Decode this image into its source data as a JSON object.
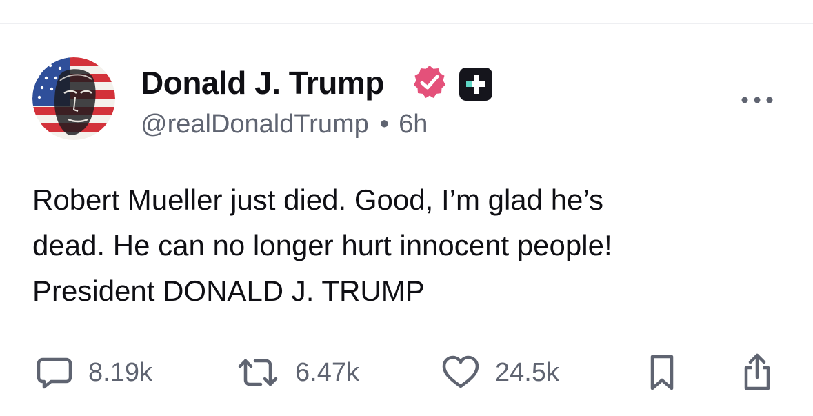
{
  "post": {
    "author": {
      "display_name": "Donald J. Trump",
      "handle": "@realDonaldTrump",
      "separator": "•",
      "time_ago": "6h",
      "avatar_icon": "flag-portrait-avatar",
      "verified_icon": "verified-badge-icon",
      "plus_icon": "plus-badge-icon"
    },
    "body": "Robert Mueller just died. Good, I’m glad he’s\ndead. He can no longer hurt innocent people!\nPresident DONALD J. TRUMP",
    "actions": {
      "reply_count": "8.19k",
      "retruth_count": "6.47k",
      "like_count": "24.5k"
    }
  },
  "colors": {
    "text_primary": "#0f0f14",
    "text_secondary": "#5f6471",
    "verified_pink": "#e4517a",
    "divider": "#eeeff2"
  }
}
